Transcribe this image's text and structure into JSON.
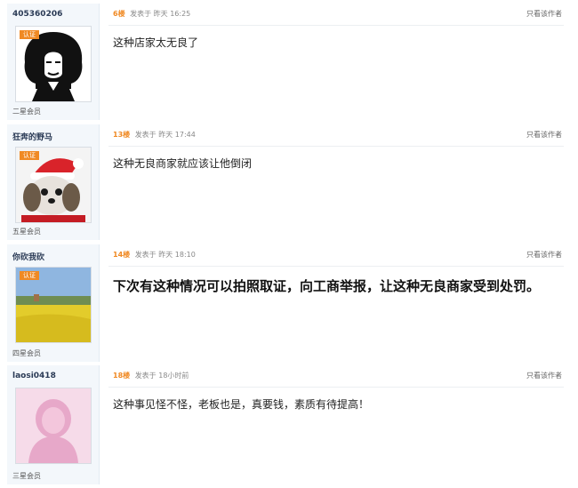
{
  "posts": [
    {
      "username": "405360206",
      "badge": "认证",
      "rank": "二星会员",
      "floor": "6楼",
      "posted": "发表于 昨天 16:25",
      "only_op": "只看该作者",
      "body": "这种店家太无良了"
    },
    {
      "username": "狂奔的野马",
      "badge": "认证",
      "rank": "五星会员",
      "floor": "13楼",
      "posted": "发表于 昨天 17:44",
      "only_op": "只看该作者",
      "body": "这种无良商家就应该让他倒闭"
    },
    {
      "username": "你砍我砍",
      "badge": "认证",
      "rank": "四星会员",
      "floor": "14楼",
      "posted": "发表于 昨天 18:10",
      "only_op": "只看该作者",
      "body": "下次有这种情况可以拍照取证，向工商举报，让这种无良商家受到处罚。"
    },
    {
      "username": "laosi0418",
      "badge": "",
      "rank": "三星会员",
      "floor": "18楼",
      "posted": "发表于 18小时前",
      "only_op": "只看该作者",
      "body": "这种事见怪不怪，老板也是，真要钱，素质有待提高！"
    }
  ],
  "colors": {
    "accent": "#f08a24",
    "side_bg": "#f3f7fb"
  }
}
